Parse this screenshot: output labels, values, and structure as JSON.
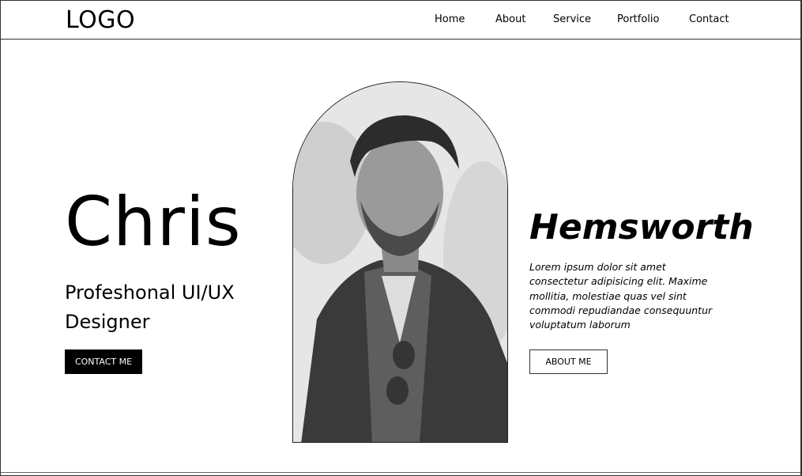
{
  "header": {
    "logo": "LOGO",
    "nav": [
      "Home",
      "About",
      "Service",
      "Portfolio",
      "Contact"
    ]
  },
  "hero": {
    "first_name": "Chris",
    "tagline": "Profeshonal UI/UX Designer",
    "contact_button": "CONTACT ME",
    "last_name": "Hemsworth",
    "bio": "Lorem ipsum dolor sit amet consectetur adipisicing elit. Maxime mollitia, molestiae quas vel sint commodi repudiandae consequuntur voluptatum laborum",
    "about_button": "ABOUT ME",
    "portrait_icon": "portrait-photo-icon"
  },
  "colors": {
    "background": "#ffffff",
    "text": "#000000",
    "button_dark": "#000000",
    "border": "#333333"
  }
}
